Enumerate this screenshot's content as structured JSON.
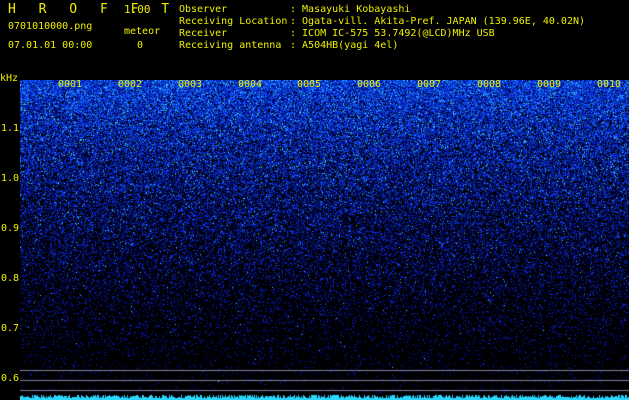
{
  "header": {
    "app_title": "H R O F F T",
    "version": "1.00",
    "filename": "0701010000.png",
    "datetime": "07.01.01 00:00",
    "meteor_label": "meteor",
    "meteor_count": "0"
  },
  "info": [
    {
      "label": "Observer",
      "value": ": Masayuki Kobayashi"
    },
    {
      "label": "Receiving Location",
      "value": ": Ogata-vill. Akita-Pref. JAPAN (139.96E, 40.02N)"
    },
    {
      "label": "Receiver",
      "value": ": ICOM IC-575 53.7492(@LCD)MHz USB"
    },
    {
      "label": "Receiving antenna",
      "value": ": A504HB(yagi 4el)"
    }
  ],
  "axis": {
    "unit_label": "kHz",
    "y_ticks": [
      "1.1",
      "1.0",
      "0.9",
      "0.8",
      "0.7",
      "0.6"
    ],
    "x_markers": [
      "0001",
      "0002",
      "0003",
      "0004",
      "0005",
      "0006",
      "0007",
      "0008",
      "0009",
      "0010"
    ]
  },
  "colors": {
    "text": "#f0f000",
    "background": "#000000",
    "noise_low": "#0a1a6a",
    "noise_high": "#4fd6ff",
    "line": "#7f7f9f"
  }
}
